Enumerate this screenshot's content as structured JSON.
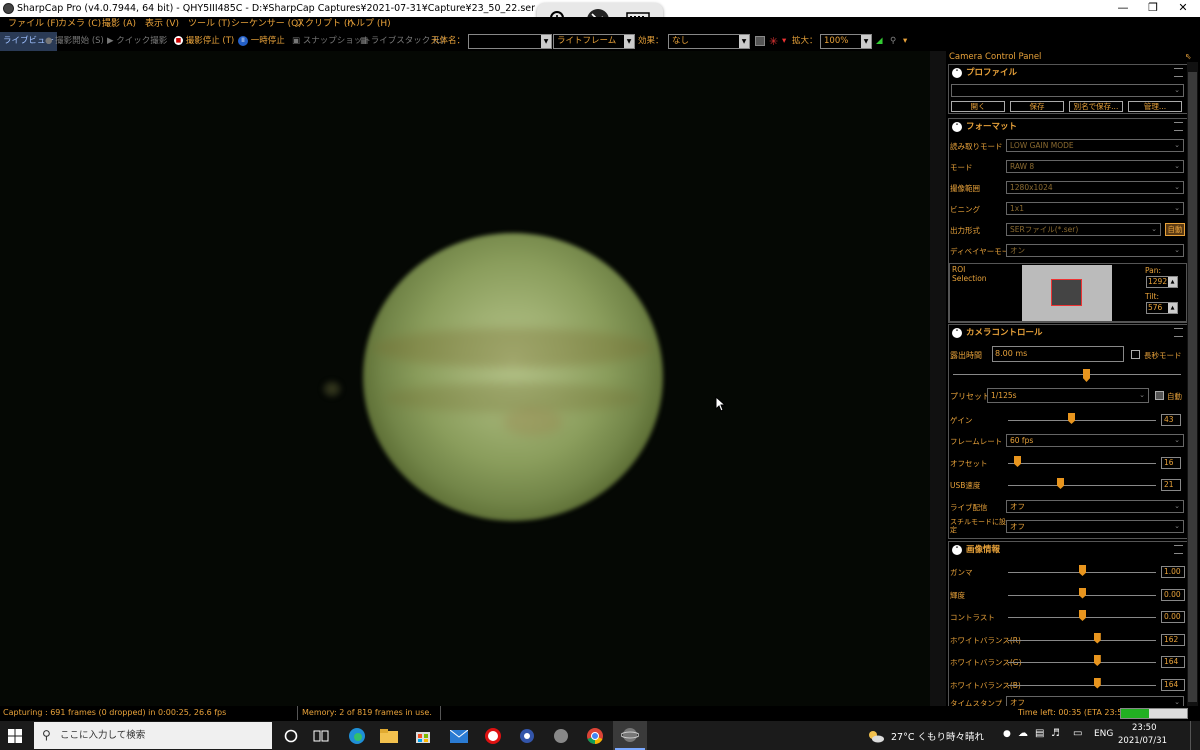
{
  "window": {
    "title": "SharpCap Pro (v4.0.7944, 64 bit) - QHY5III485C - D:¥SharpCap Captures¥2021-07-31¥Capture¥23_50_22.ser - D:¥SharpCap Captures",
    "controls": [
      "minimize",
      "restore",
      "close"
    ]
  },
  "menu": [
    "ファイル (F)",
    "カメラ (C)",
    "撮影 (A)",
    "表示 (V)",
    "ツール (T)",
    "シーケンサー (Q)",
    "スクリプト (I)",
    "ヘルプ (H)"
  ],
  "toolbar": {
    "live_view": "ライブビュー",
    "start_capture": "撮影開始 (S)",
    "quick_capture": "クイック撮影",
    "stop_capture": "撮影停止 (T)",
    "pause": "一時停止",
    "snapshot": "スナップショット",
    "live_stack": "ライブスタック (L)",
    "target_label": "天体名：",
    "target_value": "",
    "frame_type": "ライトフレーム",
    "effect_label": "効果：",
    "effect_value": "なし",
    "zoom_label": "拡大：",
    "zoom_value": "100%"
  },
  "panel": {
    "title": "Camera Control Panel",
    "profile": {
      "header": "プロファイル",
      "selected": "",
      "buttons": [
        "開く",
        "保存",
        "別名で保存...",
        "管理..."
      ]
    },
    "format": {
      "header": "フォーマット",
      "rows": [
        {
          "label": "読み取りモード",
          "value": "LOW GAIN MODE"
        },
        {
          "label": "モード",
          "value": "RAW 8"
        },
        {
          "label": "撮像範囲",
          "value": "1280x1024"
        },
        {
          "label": "ビニング",
          "value": "1x1"
        },
        {
          "label": "出力形式",
          "value": "SERファイル(*.ser)"
        },
        {
          "label": "ディベイヤーモード",
          "value": "オン"
        }
      ],
      "auto_button": "自動",
      "roi_label": "ROI Selection",
      "pan_label": "Pan:",
      "pan_value": "1292",
      "tilt_label": "Tilt:",
      "tilt_value": "576"
    },
    "camera": {
      "header": "カメラコントロール",
      "exposure_label": "露出時間",
      "exposure_value": "8.00 ms",
      "long_exposure_label": "長秒モード",
      "preset_label": "プリセット",
      "preset_value": "1/125s",
      "auto_label": "自動",
      "gain_label": "ゲイン",
      "gain_value": "43",
      "framerate_label": "フレームレート",
      "framerate_value": "60 fps",
      "offset_label": "オフセット",
      "offset_value": "16",
      "usb_label": "USB速度",
      "usb_value": "21",
      "live_label": "ライブ配信",
      "live_value": "オフ",
      "still_label": "スチルモードに設定",
      "still_value": "オフ"
    },
    "image": {
      "header": "画像情報",
      "rows": [
        {
          "label": "ガンマ",
          "value": "1.00",
          "level": 0.5
        },
        {
          "label": "輝度",
          "value": "0.00",
          "level": 0.5
        },
        {
          "label": "コントラスト",
          "value": "0.00",
          "level": 0.5
        },
        {
          "label": "ホワイトバランス(R)",
          "value": "162",
          "level": 0.6
        },
        {
          "label": "ホワイトバランス(G)",
          "value": "164",
          "level": 0.6
        },
        {
          "label": "ホワイトバランス(B)",
          "value": "164",
          "level": 0.6
        }
      ],
      "timestamp_label": "タイムスタンプ",
      "timestamp_value": "オフ"
    }
  },
  "status": {
    "capturing": "Capturing : 691 frames (0 dropped) in 0:00:25, 26.6 fps",
    "memory": "Memory: 2 of 819 frames in use.",
    "time_left": "Time left: 00:35 (ETA 23:51)",
    "progress": 0.42
  },
  "taskbar": {
    "search_placeholder": "ここに入力して検索",
    "weather": "27°C  くもり時々晴れ",
    "lang": "ENG",
    "time": "23:50",
    "date": "2021/07/31"
  },
  "colors": {
    "accent": "#e8a23a",
    "progress": "#22b022",
    "slider_thumb": "#e8951e"
  }
}
